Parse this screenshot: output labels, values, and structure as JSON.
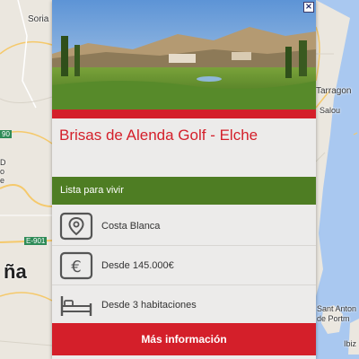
{
  "map": {
    "labels": {
      "soria": "Soria",
      "tarragona": "Tarragon",
      "salou": "Salou",
      "spain_partial": "ña",
      "sant_antoni": "Sant Anton",
      "portmany": "de Portm",
      "ibiza": "Ibiz",
      "road_90": "90",
      "road_e901": "E-901",
      "edge_d": "D",
      "edge_o": "o",
      "edge_e": "e"
    }
  },
  "card": {
    "close_label": "×",
    "title": "Brisas de Alenda Golf - Elche",
    "status": "Lista para vivir",
    "features": [
      {
        "icon": "location-pin-icon",
        "text": "Costa Blanca"
      },
      {
        "icon": "euro-icon",
        "text": "Desde 145.000€"
      },
      {
        "icon": "bed-icon",
        "text": "Desde 3 habitaciones"
      }
    ],
    "more_button": "Más información"
  },
  "colors": {
    "accent_red": "#d41f2a",
    "status_green": "#4e7d23",
    "card_bg": "#ecebea"
  }
}
